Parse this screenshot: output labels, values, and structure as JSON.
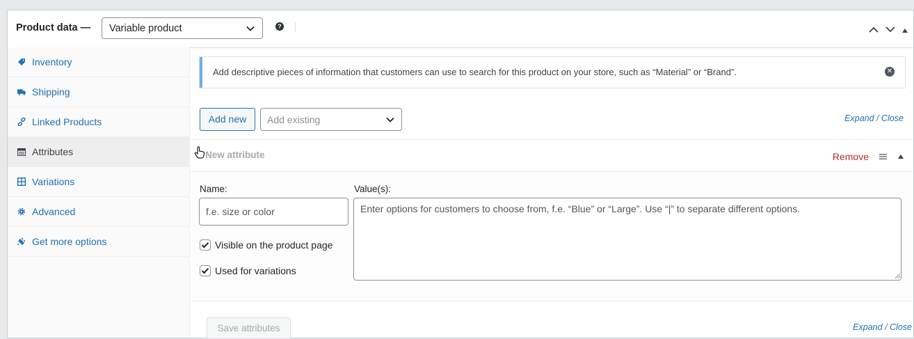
{
  "header": {
    "title": "Product data —",
    "product_type": "Variable product",
    "help_icon": "question-circle-icon",
    "arrows": [
      "chevron-up-icon",
      "chevron-down-icon",
      "triangle-up-icon"
    ]
  },
  "sidebar": {
    "items": [
      {
        "label": "Inventory",
        "icon": "tag-icon",
        "active": false
      },
      {
        "label": "Shipping",
        "icon": "truck-icon",
        "active": false
      },
      {
        "label": "Linked Products",
        "icon": "link-icon",
        "active": false
      },
      {
        "label": "Attributes",
        "icon": "table-icon",
        "active": true
      },
      {
        "label": "Variations",
        "icon": "grid-icon",
        "active": false
      },
      {
        "label": "Advanced",
        "icon": "gear-icon",
        "active": false
      },
      {
        "label": "Get more options",
        "icon": "plugin-icon",
        "active": false
      }
    ]
  },
  "notice": {
    "text": "Add descriptive pieces of information that customers can use to search for this product on your store, such as “Material” or “Brand”."
  },
  "toolbar": {
    "add_new_label": "Add new",
    "add_existing_placeholder": "Add existing",
    "expand_label": "Expand",
    "close_label": "Close",
    "slash": "/"
  },
  "attribute": {
    "title": "New attribute",
    "remove_label": "Remove",
    "name_label": "Name:",
    "name_placeholder": "f.e. size or color",
    "values_label": "Value(s):",
    "values_placeholder": "Enter options for customers to choose from, f.e. “Blue” or “Large”. Use “|” to separate different options.",
    "visible_label": "Visible on the product page",
    "visible_checked": true,
    "variations_label": "Used for variations",
    "variations_checked": true
  },
  "footer": {
    "save_label": "Save attributes",
    "expand_label": "Expand",
    "close_label": "Close",
    "slash": "/"
  },
  "colors": {
    "link": "#2271b1",
    "remove": "#b32d2e",
    "notice_border": "#72aee6",
    "active_item_bg": "#eeeeee"
  }
}
